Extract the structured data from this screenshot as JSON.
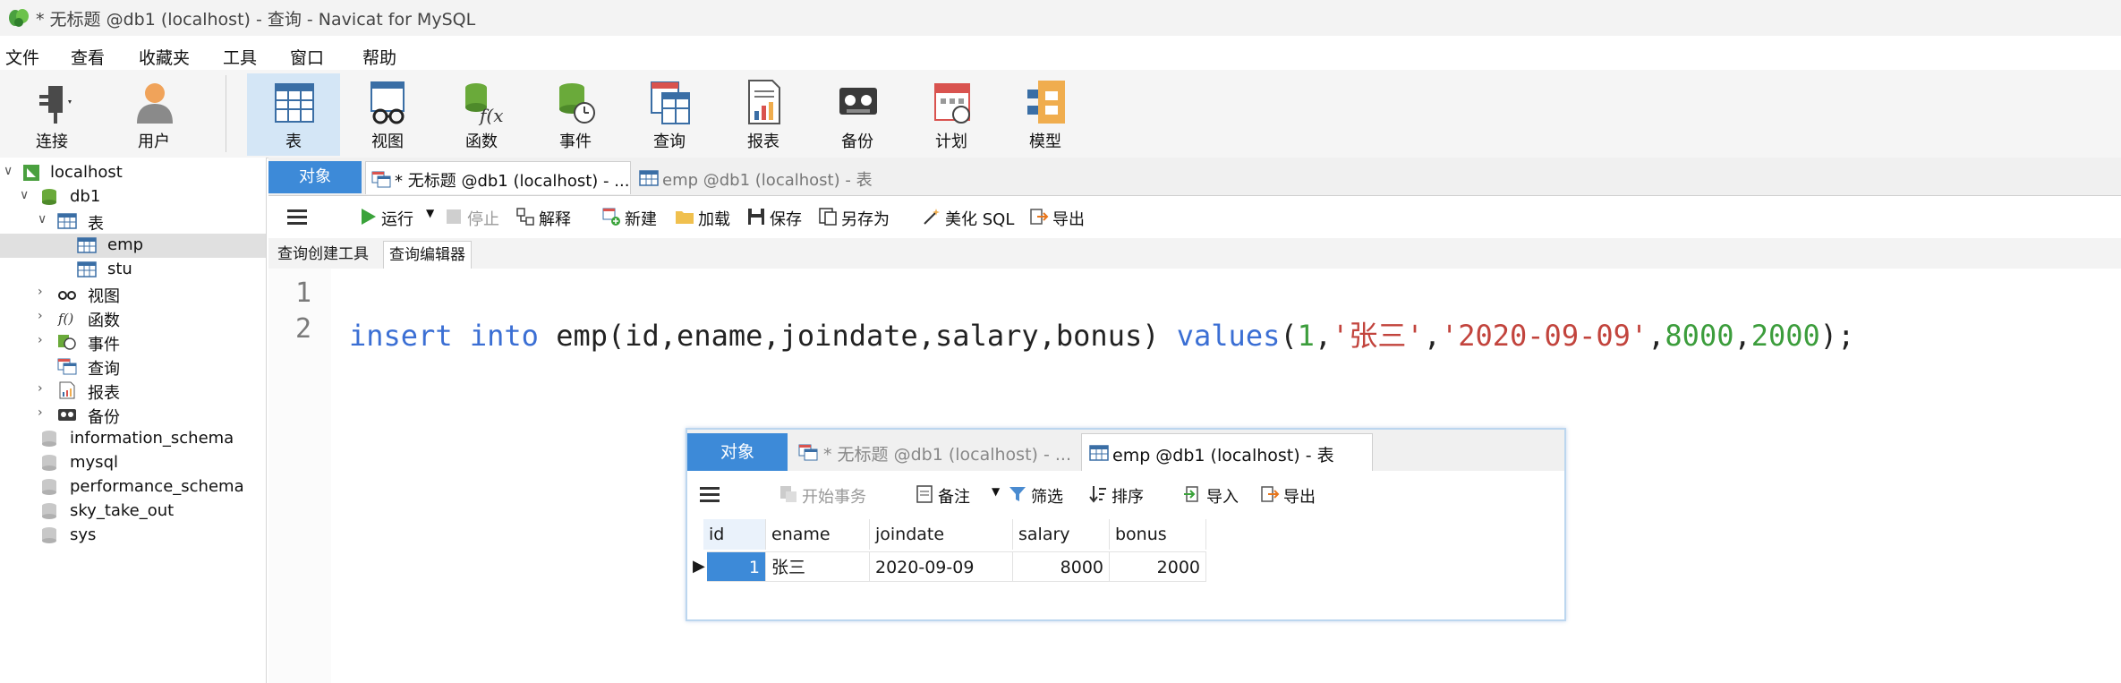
{
  "window": {
    "title": "* 无标题 @db1 (localhost) - 查询 - Navicat for MySQL"
  },
  "menu": {
    "items": [
      "文件",
      "查看",
      "收藏夹",
      "工具",
      "窗口",
      "帮助"
    ]
  },
  "toolbar": {
    "buttons": [
      {
        "label": "连接",
        "icon": "plug-icon"
      },
      {
        "label": "用户",
        "icon": "user-icon"
      },
      {
        "label": "表",
        "icon": "table-icon",
        "active": true
      },
      {
        "label": "视图",
        "icon": "view-icon"
      },
      {
        "label": "函数",
        "icon": "function-icon"
      },
      {
        "label": "事件",
        "icon": "event-icon"
      },
      {
        "label": "查询",
        "icon": "query-icon"
      },
      {
        "label": "报表",
        "icon": "report-icon"
      },
      {
        "label": "备份",
        "icon": "backup-icon"
      },
      {
        "label": "计划",
        "icon": "schedule-icon"
      },
      {
        "label": "模型",
        "icon": "model-icon"
      }
    ]
  },
  "sidebar": {
    "connection": "localhost",
    "database": "db1",
    "tables_group": "表",
    "tables": [
      "emp",
      "stu"
    ],
    "selected_table": "emp",
    "groups": [
      "视图",
      "函数",
      "事件",
      "查询",
      "报表",
      "备份"
    ],
    "other_databases": [
      "information_schema",
      "mysql",
      "performance_schema",
      "sky_take_out",
      "sys"
    ]
  },
  "tabs": {
    "objects": "对象",
    "query_tab": "* 无标题 @db1 (localhost) - ...",
    "table_tab": "emp @db1 (localhost) - 表"
  },
  "query_toolbar": {
    "run": "运行",
    "stop": "停止",
    "explain": "解释",
    "new": "新建",
    "load": "加载",
    "save": "保存",
    "save_as": "另存为",
    "beautify": "美化 SQL",
    "export": "导出"
  },
  "subtabs": {
    "builder": "查询创建工具",
    "editor": "查询编辑器"
  },
  "editor": {
    "line_numbers": [
      "1",
      "2"
    ],
    "tokens": {
      "kw_insert": "insert",
      "kw_into": "into",
      "t1": "emp(id,ename,joindate,salary,bonus)",
      "kw_values": "values",
      "p_open": "(",
      "n1": "1",
      "c1": ",",
      "s1": "'张三'",
      "c2": ",",
      "s2": "'2020-09-09'",
      "c3": ",",
      "n2": "8000",
      "c4": ",",
      "n3": "2000",
      "p_close": ");"
    }
  },
  "overlay": {
    "tabs": {
      "objects": "对象",
      "query_tab": "* 无标题 @db1 (localhost) - ...",
      "table_tab": "emp @db1 (localhost) - 表"
    },
    "toolbar": {
      "begin_tx": "开始事务",
      "note": "备注",
      "filter": "筛选",
      "sort": "排序",
      "import": "导入",
      "export": "导出"
    },
    "grid": {
      "columns": [
        "id",
        "ename",
        "joindate",
        "salary",
        "bonus"
      ],
      "rows": [
        [
          "1",
          "张三",
          "2020-09-09",
          "8000",
          "2000"
        ]
      ]
    }
  },
  "colors": {
    "accent": "#3d8ad8",
    "keyword": "#3b6fd4",
    "number": "#3c9d3c",
    "string": "#c2443d"
  }
}
